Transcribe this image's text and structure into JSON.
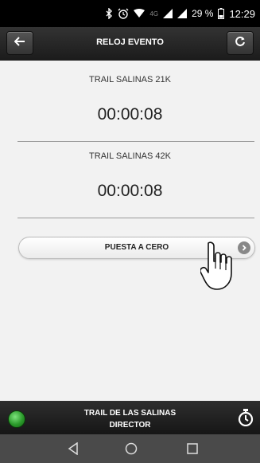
{
  "status_bar": {
    "network": "4G",
    "battery_percent": "29 %",
    "time": "12:29"
  },
  "header": {
    "title": "RELOJ EVENTO"
  },
  "races": [
    {
      "name": "TRAIL SALINAS 21K",
      "elapsed": "00:00:08"
    },
    {
      "name": "TRAIL SALINAS 42K",
      "elapsed": "00:00:08"
    }
  ],
  "reset_button": {
    "label": "PUESTA A CERO"
  },
  "footer": {
    "event_name": "TRAIL DE LAS SALINAS",
    "role": "DIRECTOR",
    "status_color": "#2b9a2b"
  },
  "icons": [
    "back-arrow-icon",
    "refresh-icon",
    "chevron-right-icon",
    "hand-pointer-icon",
    "stopwatch-icon",
    "back-nav-icon",
    "home-nav-icon",
    "recents-nav-icon"
  ]
}
